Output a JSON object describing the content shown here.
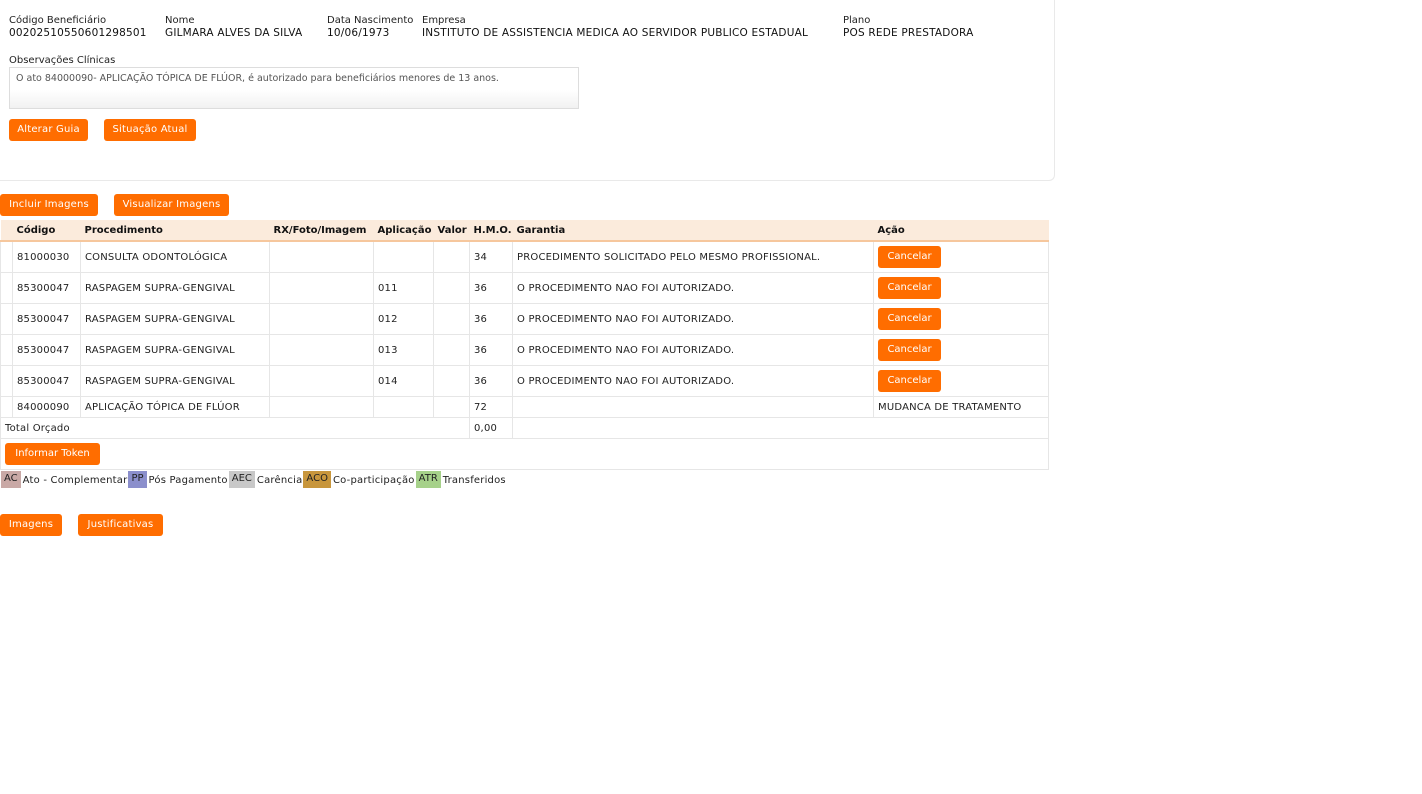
{
  "beneficiary": {
    "codigo_label": "Código Beneficiário",
    "codigo_value": "0020251055060129850 1",
    "nome_label": "Nome",
    "nome_value": "GILMARA ALVES DA SILVA",
    "nascimento_label": "Data Nascimento",
    "nascimento_value": "10/06/1973",
    "empresa_label": "Empresa",
    "empresa_value": "INSTITUTO DE ASSISTENCIA MEDICA AO SERVIDOR PUBLICO ESTADUAL",
    "plano_label": "Plano",
    "plano_value": "POS REDE PRESTADORA"
  },
  "observacoes": {
    "label": "Observações Clínicas",
    "text": "O ato 84000090- APLICAÇÃO TÓPICA DE FLÚOR, é autorizado para beneficiários menores de 13 anos."
  },
  "actions": {
    "alterar_guia": "Alterar Guia",
    "situacao_atual": "Situação Atual",
    "incluir_imagens": "Incluir Imagens",
    "visualizar_imagens": "Visualizar Imagens",
    "informar_token": "Informar Token",
    "imagens": "Imagens",
    "justificativas": "Justificativas"
  },
  "table": {
    "headers": {
      "codigo": "Código",
      "procedimento": "Procedimento",
      "rx": "RX/Foto/Imagem",
      "aplicacao": "Aplicação",
      "valor": "Valor",
      "hmo": "H.M.O.",
      "garantia": "Garantia",
      "acao": "Ação"
    },
    "rows": [
      {
        "codigo": "81000030",
        "procedimento": "CONSULTA ODONTOLÓGICA",
        "rx": "",
        "aplicacao": "",
        "valor": "",
        "hmo": "34",
        "garantia": "PROCEDIMENTO SOLICITADO PELO MESMO PROFISSIONAL.",
        "acao": "Cancelar"
      },
      {
        "codigo": "85300047",
        "procedimento": "RASPAGEM SUPRA-GENGIVAL",
        "rx": "",
        "aplicacao": "011",
        "valor": "",
        "hmo": "36",
        "garantia": "O PROCEDIMENTO NAO FOI AUTORIZADO.",
        "acao": "Cancelar"
      },
      {
        "codigo": "85300047",
        "procedimento": "RASPAGEM SUPRA-GENGIVAL",
        "rx": "",
        "aplicacao": "012",
        "valor": "",
        "hmo": "36",
        "garantia": "O PROCEDIMENTO NAO FOI AUTORIZADO.",
        "acao": "Cancelar"
      },
      {
        "codigo": "85300047",
        "procedimento": "RASPAGEM SUPRA-GENGIVAL",
        "rx": "",
        "aplicacao": "013",
        "valor": "",
        "hmo": "36",
        "garantia": "O PROCEDIMENTO NAO FOI AUTORIZADO.",
        "acao": "Cancelar"
      },
      {
        "codigo": "85300047",
        "procedimento": "RASPAGEM SUPRA-GENGIVAL",
        "rx": "",
        "aplicacao": "014",
        "valor": "",
        "hmo": "36",
        "garantia": "O PROCEDIMENTO NAO FOI AUTORIZADO.",
        "acao": "Cancelar"
      },
      {
        "codigo": "84000090",
        "procedimento": "APLICAÇÃO TÓPICA DE FLÚOR",
        "rx": "",
        "aplicacao": "",
        "valor": "",
        "hmo": "72",
        "garantia": "",
        "acao": "MUDANCA DE TRATAMENTO"
      }
    ],
    "total_label": "Total Orçado",
    "total_value": "0,00"
  },
  "legend": [
    {
      "code": "AC",
      "label": "Ato - Complementar",
      "color": "#c9a9a6"
    },
    {
      "code": "PP",
      "label": "Pós Pagamento",
      "color": "#8b8fcc"
    },
    {
      "code": "AEC",
      "label": "Carência",
      "color": "#c8c8c8"
    },
    {
      "code": "ACO",
      "label": "Co-participação",
      "color": "#c8963c"
    },
    {
      "code": "ATR",
      "label": "Transferidos",
      "color": "#a6d18a"
    }
  ],
  "colors": {
    "accent": "#ff6d00",
    "header_bg": "#fbebdc"
  }
}
